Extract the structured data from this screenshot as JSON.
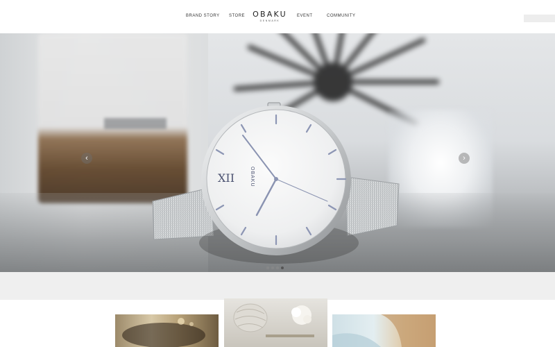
{
  "header": {
    "nav_left": [
      "BRAND STORY",
      "STORE"
    ],
    "nav_right": [
      "EVENT",
      "COMMUNITY"
    ],
    "logo_main": "OBAKU",
    "logo_sub": "DENMARK"
  },
  "hero": {
    "watch_brand": "OBAKU",
    "watch_numeral": "XII",
    "prev_label": "‹",
    "next_label": "›",
    "slides_count": 4,
    "active_slide": 4
  },
  "icons": {
    "prev": "chevron-left-icon",
    "next": "chevron-right-icon"
  },
  "colors": {
    "header_bg": "#ffffff",
    "band_bg": "#efefef",
    "active_dot": "#555555"
  }
}
